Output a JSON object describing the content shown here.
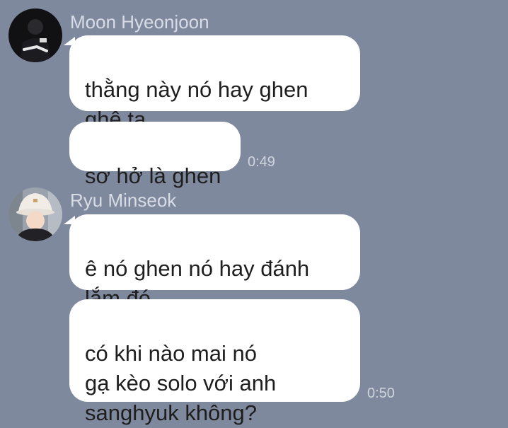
{
  "theme": {
    "background": "#7f899e",
    "bubble": "#ffffff",
    "sender_color": "#d7dce6",
    "time_color": "#cfd4dd"
  },
  "groups": [
    {
      "sender": "Moon Hyeonjoon",
      "avatar_icon": "profile-photo-dark",
      "messages": [
        {
          "text": "thằng này nó hay ghen\nghê ta"
        },
        {
          "text": "sơ hở là ghen",
          "time": "0:49"
        }
      ]
    },
    {
      "sender": "Ryu Minseok",
      "avatar_icon": "profile-photo-bucket-hat",
      "messages": [
        {
          "text": "ê nó ghen nó hay đánh\nlắm đó"
        },
        {
          "text": "có khi nào mai nó\ngạ kèo solo với anh\nsanghyuk không?",
          "time": "0:50"
        }
      ]
    }
  ]
}
